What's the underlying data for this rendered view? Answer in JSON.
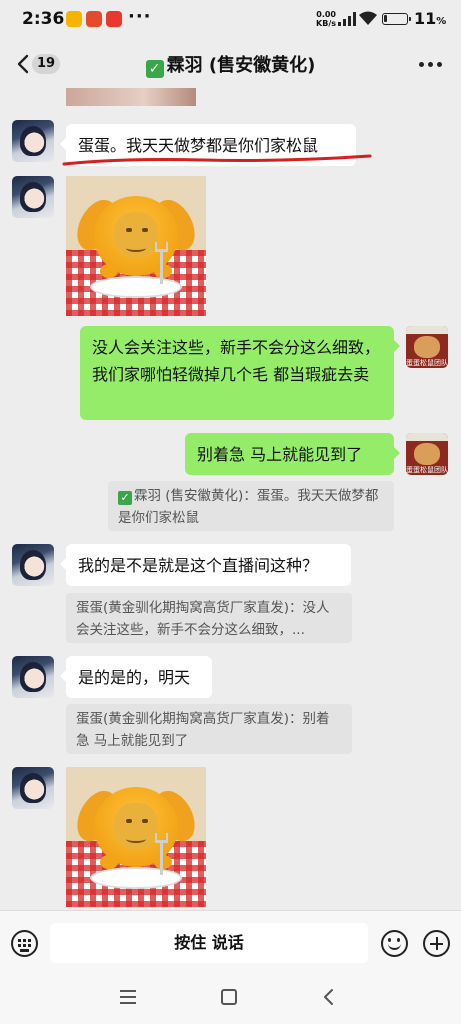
{
  "status_bar": {
    "time": "2:36",
    "network_speed": "0.00",
    "network_unit": "KB/s",
    "network_type": "4G",
    "battery_level": "11",
    "battery_unit": "%"
  },
  "header": {
    "unread_count": "19",
    "title": "霖羽 (售安徽黄化)",
    "title_icon": "green-check-icon"
  },
  "messages": [
    {
      "id": "partial-image",
      "side": "left",
      "type": "image"
    },
    {
      "id": "m1",
      "side": "left",
      "type": "text",
      "text": "蛋蛋。我天天做梦都是你们家松鼠",
      "highlighted_by": "red underline"
    },
    {
      "id": "m2",
      "side": "left",
      "type": "sticker",
      "sticker": "dog-with-fork-and-plate"
    },
    {
      "id": "m3",
      "side": "right",
      "type": "text",
      "text": "没人会关注这些，新手不会分这么细致，我们家哪怕轻微掉几个毛 都当瑕疵去卖"
    },
    {
      "id": "m4",
      "side": "right",
      "type": "text",
      "text": "别着急 马上就能见到了",
      "quote": "霖羽 (售安徽黄化)：蛋蛋。我天天做梦都是你们家松鼠"
    },
    {
      "id": "m5",
      "side": "left",
      "type": "text",
      "text": "我的是不是就是这个直播间这种？",
      "quote": "蛋蛋(黄金驯化期掏窝高货厂家直发)：没人会关注这些，新手不会分这么细致，..."
    },
    {
      "id": "m6",
      "side": "left",
      "type": "text",
      "text": "是的是的，明天",
      "quote": "蛋蛋(黄金驯化期掏窝高货厂家直发)：别着急 马上就能见到了"
    },
    {
      "id": "m7",
      "side": "left",
      "type": "sticker",
      "sticker": "dog-with-fork-and-plate"
    }
  ],
  "self_avatar_caption": "蛋蛋松鼠团队",
  "input_bar": {
    "voice_label": "按住 说话",
    "left_icon": "keyboard-icon",
    "emoji_icon": "emoji-icon",
    "plus_icon": "plus-icon"
  },
  "colors": {
    "background": "#ededed",
    "own_bubble": "#95ec69",
    "other_bubble": "#ffffff",
    "quote_bg": "#e3e3e3",
    "highlight_line": "#d42020"
  }
}
